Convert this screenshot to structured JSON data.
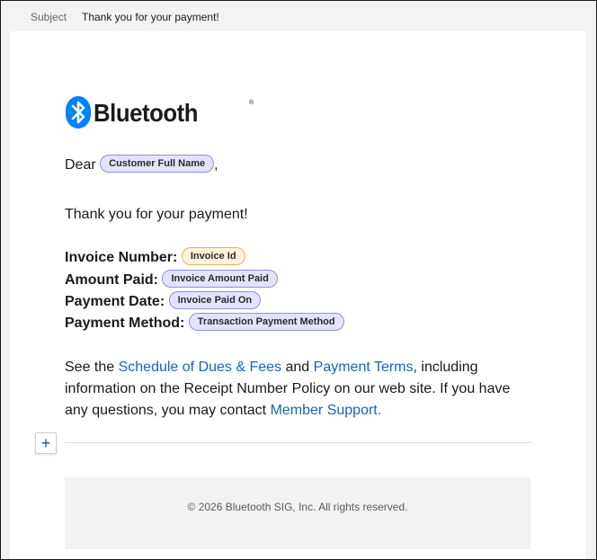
{
  "subject": {
    "label": "Subject",
    "value": "Thank you for your payment!"
  },
  "logo": {
    "text": "Bluetooth",
    "mark": "®",
    "icon": "bluetooth-icon",
    "color": "#0082fc"
  },
  "greeting": {
    "prefix": "Dear",
    "token": "Customer Full Name",
    "suffix": ","
  },
  "thanks": "Thank you for your payment!",
  "fields": [
    {
      "label": "Invoice Number:",
      "token": "Invoice Id"
    },
    {
      "label": "Amount Paid:",
      "token": "Invoice Amount Paid"
    },
    {
      "label": "Payment Date:",
      "token": "Invoice Paid On"
    },
    {
      "label": "Payment Method:",
      "token": "Transaction Payment Method"
    }
  ],
  "paragraph": {
    "t1": "See the ",
    "link1": "Schedule of Dues & Fees",
    "t2": " and ",
    "link2": "Payment Terms",
    "t3": ", including information on the Receipt Number Policy on our web site. If you have any questions, you may contact ",
    "link3": "Member Support",
    "t4": "."
  },
  "add_button": {
    "label": "+"
  },
  "footer": {
    "text": "© 2026 Bluetooth SIG, Inc. All rights reserved."
  },
  "colors": {
    "link": "#1565c0",
    "pill_purple": "#e3e3fb",
    "pill_orange": "#fdf2de"
  }
}
